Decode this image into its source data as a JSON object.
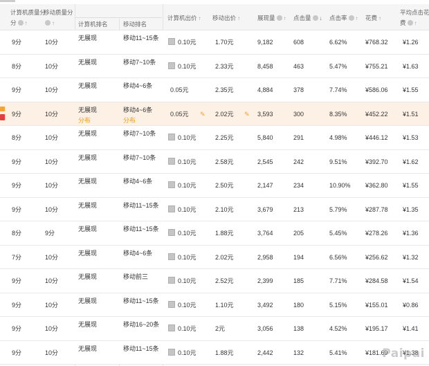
{
  "header": {
    "pc_quality": "计算机质量分",
    "mobile_quality": "移动质量分",
    "pc_rank": "计算机排名",
    "mobile_rank": "移动排名",
    "pc_bid": "计算机出价",
    "mobile_bid": "移动出价",
    "impressions": "展现量",
    "clicks": "点击量",
    "ctr": "点击率",
    "cost": "花费",
    "avg_cpc_line1": "平均点击花",
    "avg_cpc_line2": "费"
  },
  "highlight_row_index": 3,
  "rows": [
    {
      "pcq": "9分",
      "mq": "10分",
      "pcr": "无展现",
      "mr": "移动11~15条",
      "pcb": "0.10元",
      "pcb_check": true,
      "mb": "1.70元",
      "imp": "9,182",
      "clk": "608",
      "ctr": "6.62%",
      "cost": "¥768.32",
      "cpc": "¥1.26"
    },
    {
      "pcq": "8分",
      "mq": "10分",
      "pcr": "无展现",
      "mr": "移动7~10条",
      "pcb": "0.10元",
      "pcb_check": true,
      "mb": "2.33元",
      "imp": "8,458",
      "clk": "463",
      "ctr": "5.47%",
      "cost": "¥755.21",
      "cpc": "¥1.63"
    },
    {
      "pcq": "9分",
      "mq": "10分",
      "pcr": "无展现",
      "mr": "移动4~6条",
      "pcb": "0.05元",
      "pcb_check": false,
      "mb": "2.35元",
      "imp": "4,884",
      "clk": "378",
      "ctr": "7.74%",
      "cost": "¥586.06",
      "cpc": "¥1.55"
    },
    {
      "pcq": "9分",
      "mq": "10分",
      "pcr": "无展现",
      "pcr_sub": "分布",
      "mr": "移动4~6条",
      "mr_sub": "分布",
      "pcb": "0.05元",
      "pcb_check": false,
      "mb": "2.02元",
      "imp": "3,593",
      "clk": "300",
      "ctr": "8.35%",
      "cost": "¥452.22",
      "cpc": "¥1.51",
      "editable": true
    },
    {
      "pcq": "8分",
      "mq": "10分",
      "pcr": "无展现",
      "mr": "移动7~10条",
      "pcb": "0.10元",
      "pcb_check": true,
      "mb": "2.25元",
      "imp": "5,840",
      "clk": "291",
      "ctr": "4.98%",
      "cost": "¥446.12",
      "cpc": "¥1.53"
    },
    {
      "pcq": "9分",
      "mq": "10分",
      "pcr": "无展现",
      "mr": "移动7~10条",
      "pcb": "0.10元",
      "pcb_check": true,
      "mb": "2.58元",
      "imp": "2,545",
      "clk": "242",
      "ctr": "9.51%",
      "cost": "¥392.70",
      "cpc": "¥1.62"
    },
    {
      "pcq": "9分",
      "mq": "10分",
      "pcr": "无展现",
      "mr": "移动4~6条",
      "pcb": "0.10元",
      "pcb_check": true,
      "mb": "2.50元",
      "imp": "2,147",
      "clk": "234",
      "ctr": "10.90%",
      "cost": "¥362.80",
      "cpc": "¥1.55"
    },
    {
      "pcq": "9分",
      "mq": "10分",
      "pcr": "无展现",
      "mr": "移动11~15条",
      "pcb": "0.10元",
      "pcb_check": true,
      "mb": "2.10元",
      "imp": "3,679",
      "clk": "213",
      "ctr": "5.79%",
      "cost": "¥287.78",
      "cpc": "¥1.35"
    },
    {
      "pcq": "8分",
      "mq": "9分",
      "pcr": "无展现",
      "mr": "移动11~15条",
      "pcb": "0.10元",
      "pcb_check": true,
      "mb": "1.88元",
      "imp": "3,764",
      "clk": "205",
      "ctr": "5.45%",
      "cost": "¥278.26",
      "cpc": "¥1.36"
    },
    {
      "pcq": "7分",
      "mq": "10分",
      "pcr": "无展现",
      "mr": "移动4~6条",
      "pcb": "0.10元",
      "pcb_check": true,
      "mb": "2.02元",
      "imp": "2,958",
      "clk": "194",
      "ctr": "6.56%",
      "cost": "¥256.62",
      "cpc": "¥1.32"
    },
    {
      "pcq": "9分",
      "mq": "10分",
      "pcr": "无展现",
      "mr": "移动前三",
      "pcb": "0.10元",
      "pcb_check": true,
      "mb": "2.52元",
      "imp": "2,399",
      "clk": "185",
      "ctr": "7.71%",
      "cost": "¥284.58",
      "cpc": "¥1.54"
    },
    {
      "pcq": "9分",
      "mq": "10分",
      "pcr": "无展现",
      "mr": "移动11~15条",
      "pcb": "0.10元",
      "pcb_check": true,
      "mb": "1.10元",
      "imp": "3,492",
      "clk": "180",
      "ctr": "5.15%",
      "cost": "¥155.01",
      "cpc": "¥0.86"
    },
    {
      "pcq": "9分",
      "mq": "10分",
      "pcr": "无展现",
      "mr": "移动16~20条",
      "pcb": "0.10元",
      "pcb_check": true,
      "mb": "2元",
      "imp": "3,056",
      "clk": "138",
      "ctr": "4.52%",
      "cost": "¥195.17",
      "cpc": "¥1.41"
    },
    {
      "pcq": "9分",
      "mq": "10分",
      "pcr": "无展现",
      "mr": "移动11~15条",
      "pcb": "0.10元",
      "pcb_check": true,
      "mb": "1.88元",
      "imp": "2,442",
      "clk": "132",
      "ctr": "5.41%",
      "cost": "¥181.69",
      "cpc": "¥1.38"
    }
  ],
  "watermark": "Paipai",
  "icons": {
    "help": "question-circle-icon",
    "sort": "sort-arrow-icon",
    "edit": "pencil-icon",
    "bid_toggle": "checkbox-icon"
  },
  "colors": {
    "accent_orange": "#f39c12",
    "highlight_row": "#fdf1e6",
    "sort_active": "#2b86d8"
  }
}
